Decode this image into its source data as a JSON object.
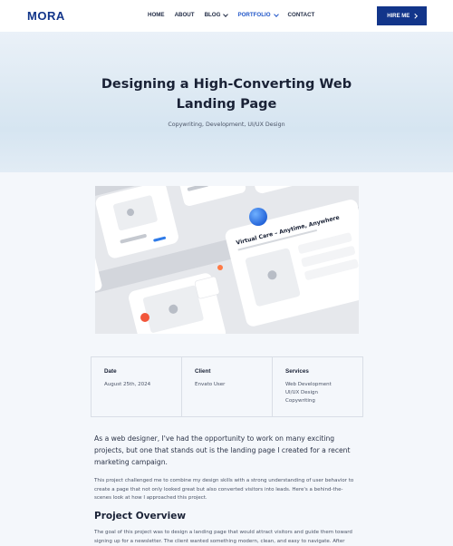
{
  "header": {
    "logo": "MORA",
    "nav": [
      {
        "label": "HOME",
        "dropdown": false,
        "active": false
      },
      {
        "label": "ABOUT",
        "dropdown": false,
        "active": false
      },
      {
        "label": "BLOG",
        "dropdown": true,
        "active": false
      },
      {
        "label": "PORTFOLIO",
        "dropdown": true,
        "active": true
      },
      {
        "label": "CONTACT",
        "dropdown": false,
        "active": false
      }
    ],
    "hire_label": "HIRE ME"
  },
  "hero": {
    "title": "Designing a High-Converting Web Landing Page",
    "subtitle": "Copywriting, Development, UI/UX Design"
  },
  "showcase": {
    "card_title": "Virtual Care – Anytime, Anywhere",
    "accent_color": "#2f7be8"
  },
  "info": [
    {
      "label": "Date",
      "values": [
        "August 25th, 2024"
      ]
    },
    {
      "label": "Client",
      "values": [
        "Envato User"
      ]
    },
    {
      "label": "Services",
      "values": [
        "Web Development",
        "UI/UX Design",
        "Copywriting"
      ]
    }
  ],
  "article": {
    "lead": "As a web designer, I've had the opportunity to work on many exciting projects, but one that stands out is the landing page I created for a recent marketing campaign.",
    "p1": "This project challenged me to combine my design skills with a strong understanding of user behavior to create a page that not only looked great but also converted visitors into leads. Here's a behind-the-scenes look at how I approached this project.",
    "h2": "Project Overview",
    "p2": "The goal of this project was to design a landing page that would attract visitors and guide them toward signing up for a newsletter. The client wanted something modern, clean, and easy to navigate. After"
  },
  "colors": {
    "brand": "#12358a",
    "nav_active": "#2257c9"
  }
}
